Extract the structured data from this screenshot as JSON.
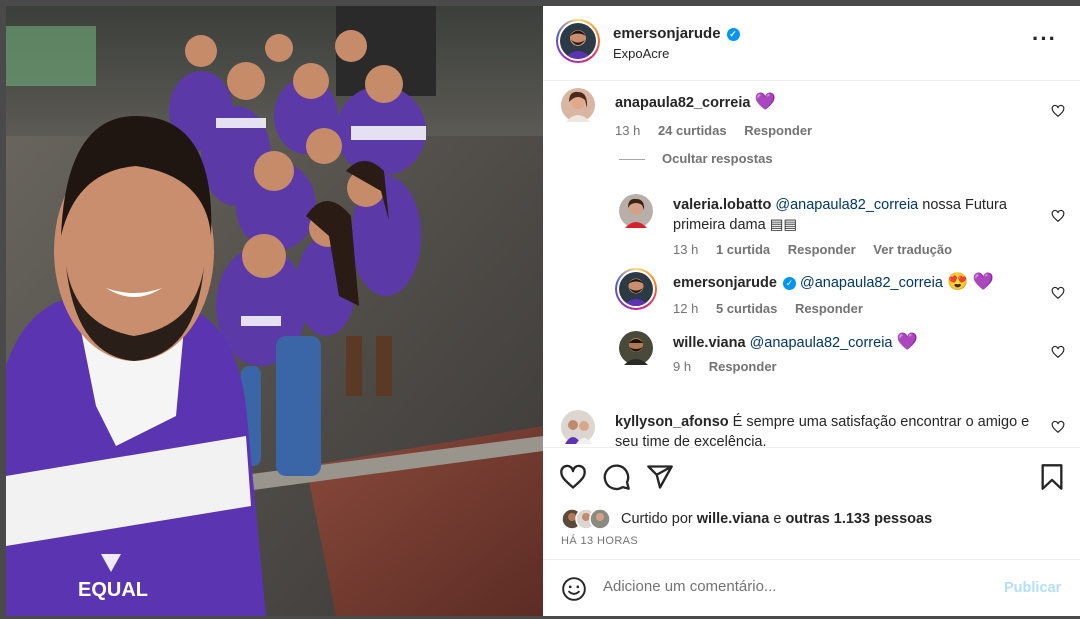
{
  "post": {
    "author": "emersonjarude",
    "location": "ExpoAcre",
    "image_alt": "Selfie de grupo com equipe uniformizada em roxo e branco",
    "image_brand": "EQUAL"
  },
  "header": {
    "verified_icon": "verified-badge-icon",
    "more_icon": "more-options-icon"
  },
  "comments": [
    {
      "user": "anapaula82_correia",
      "emoji": "💜",
      "time": "13 h",
      "likes": "24 curtidas",
      "reply": "Responder"
    }
  ],
  "replies_toggle": "Ocultar respostas",
  "replies": [
    {
      "user": "valeria.lobatto",
      "mention": "@anapaula82_correia",
      "text": " nossa Futura primeira dama ",
      "emoji": "▤▤",
      "time": "13 h",
      "likes": "1 curtida",
      "reply": "Responder",
      "translate": "Ver tradução"
    },
    {
      "user": "emersonjarude",
      "mention": "@anapaula82_correia",
      "emoji": "😍 💜",
      "time": "12 h",
      "likes": "5 curtidas",
      "reply": "Responder"
    },
    {
      "user": "wille.viana",
      "mention": "@anapaula82_correia",
      "emoji": "💜",
      "time": "9 h",
      "reply": "Responder"
    }
  ],
  "comment2": {
    "user": "kyllyson_afonso",
    "text": " É sempre uma satisfação encontrar o amigo e seu time de excelência."
  },
  "likes_line": {
    "prefix": "Curtido por ",
    "user": "wille.viana",
    "middle": " e ",
    "others": "outras 1.133 pessoas"
  },
  "time_ago": "HÁ 13 HORAS",
  "composer": {
    "placeholder": "Adicione um comentário...",
    "publish": "Publicar"
  },
  "colors": {
    "accent_blue": "#0095f6",
    "mention": "#00376b",
    "muted": "#737373",
    "publish_disabled": "#b2dffc"
  }
}
